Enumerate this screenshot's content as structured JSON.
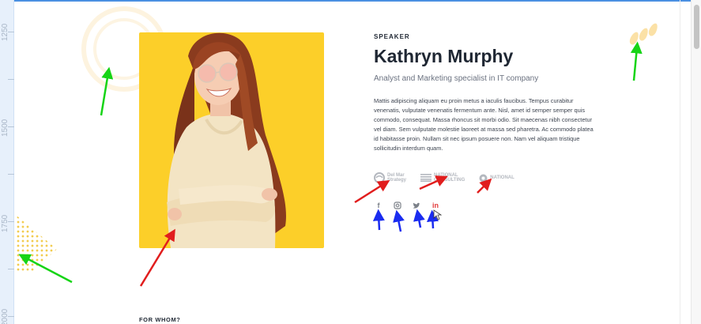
{
  "ruler": {
    "ticks": [
      "1250",
      "1500",
      "1750",
      "2000"
    ]
  },
  "speaker": {
    "eyebrow": "SPEAKER",
    "name": "Kathryn Murphy",
    "role": "Analyst and Marketing specialist in IT company",
    "bio": "Mattis adipiscing aliquam eu proin metus a iaculis faucibus. Tempus curabitur venenatis, vulputate venenatis fermentum ante. Nisl, amet id semper semper quis commodo, consequat. Massa rhoncus sit morbi odio. Sit maecenas nibh consectetur vel diam. Sem vulputate molestie laoreet at massa sed pharetra. Ac commodo platea id habitasse proin. Nullam sit nec ipsum posuere non. Nam vel aliquam tristique sollicitudin interdum quam.",
    "logos": [
      {
        "line1": "Del Mar",
        "line2": "Strategy"
      },
      {
        "line1": "NATIONAL",
        "line2": "CONSULTING"
      },
      {
        "line1": "NATIONAL",
        "line2": ""
      }
    ],
    "socials": [
      "facebook",
      "instagram",
      "twitter",
      "linkedin"
    ],
    "photo_bg": "#fccf29"
  },
  "next_section": {
    "heading": "FOR WHOM?"
  },
  "colors": {
    "accent_yellow": "#fccf29",
    "text_dark": "#1f2733",
    "linkedin_active": "#e23b3b",
    "arrow_red": "#e11d1d",
    "arrow_green": "#16d416",
    "arrow_blue": "#1a2cf0"
  }
}
